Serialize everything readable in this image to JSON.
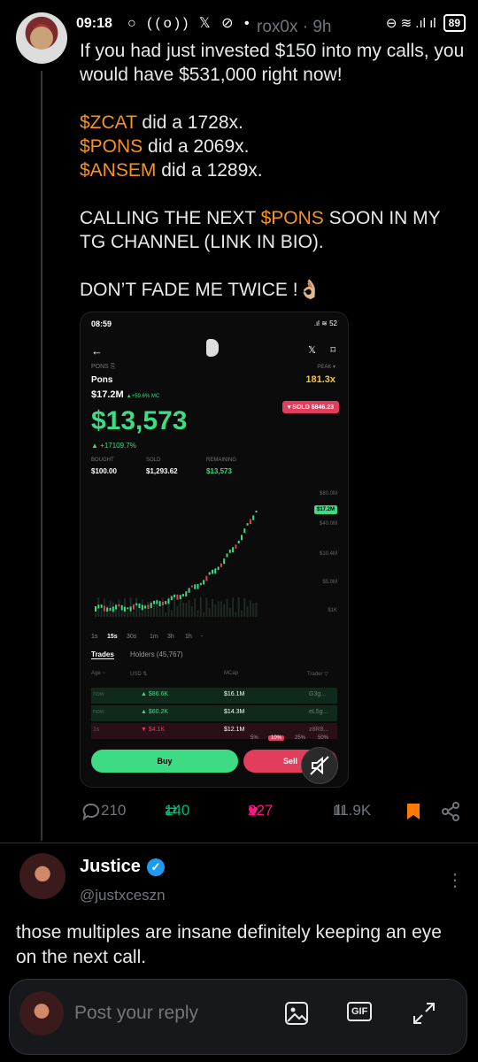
{
  "status_bar": {
    "time": "09:18",
    "icons": "○ ((o)) 𝕏 ⊘ •",
    "signal": "⊖ ≋ .ıl ıl",
    "battery": "89"
  },
  "tweet": {
    "handle_time": "rox0x · 9h",
    "line1": "If you had just invested $150 into my calls, you would have $531,000 right now!",
    "calls": [
      {
        "ticker": "$ZCAT",
        "rest": " did a 1728x."
      },
      {
        "ticker": "$PONS",
        "rest": " did a 2069x."
      },
      {
        "ticker": "$ANSEM",
        "rest": " did a 1289x."
      }
    ],
    "calling_pre": "CALLING THE NEXT ",
    "calling_ticker": "$PONS",
    "calling_post": " SOON IN MY TG CHANNEL (LINK IN BIO).",
    "closing": "DON’T FADE ME TWICE !👌🏼"
  },
  "screenshot": {
    "time": "08:59",
    "status": ".ıl ≋ 52",
    "ticker_label": "PONS ⎘",
    "name": "Pons",
    "market_cap": "$17.2M",
    "mc_change": "▲+59.6% MC",
    "peak_label": "PEAK ▾",
    "peak": "181.3x",
    "sold_badge": "▾ SOLD $846.23",
    "value": "$13,573",
    "gain": "▲ +17109.7%",
    "stats": [
      {
        "label": "BOUGHT",
        "value": "$100.00"
      },
      {
        "label": "SOLD",
        "value": "$1,293.62"
      },
      {
        "label": "REMAINING",
        "value": "$13,573"
      }
    ],
    "y_labels": [
      "$80.0M",
      "$40.0M",
      "$20.0M",
      "$10.4M",
      "$5.0M",
      "$1K"
    ],
    "y_badge": "$17.2M",
    "timeframes": [
      "1s",
      "15s",
      "30s",
      "1m",
      "3h",
      "1h",
      "-"
    ],
    "tabs": [
      "Trades",
      "Holders (45,767)"
    ],
    "headers": [
      "Age ~",
      "USD ⇅",
      "MCap",
      "Trader ▽"
    ],
    "trades": [
      {
        "age": "now",
        "usd": "▲ $86.6K",
        "mcap": "$16.1M",
        "trader": "G3g...",
        "up": true
      },
      {
        "age": "now",
        "usd": "▲ $60.2K",
        "mcap": "$14.3M",
        "trader": "eL5g...",
        "up": true
      },
      {
        "age": "1s",
        "usd": "▼ $4.1K",
        "mcap": "$12.1M",
        "trader": "z8R8...",
        "up": false
      }
    ],
    "percents": [
      "5%",
      "10%",
      "25%",
      "50%"
    ],
    "buy_label": "Buy",
    "sell_label": "Sell"
  },
  "actions": {
    "replies": "210",
    "retweets": "140",
    "likes": "227",
    "views": "11.9K"
  },
  "reply": {
    "name": "Justice",
    "handle": "@justxceszn",
    "text": "those multiples are insane definitely keeping an eye on the next call."
  },
  "composer": {
    "placeholder": "Post your reply",
    "gif": "GIF"
  },
  "colors": {
    "accent": "#1d9bf0",
    "cashtag": "#f7931a",
    "like": "#f91880",
    "retweet": "#00ba7c",
    "bookmark": "#ff7a00"
  }
}
